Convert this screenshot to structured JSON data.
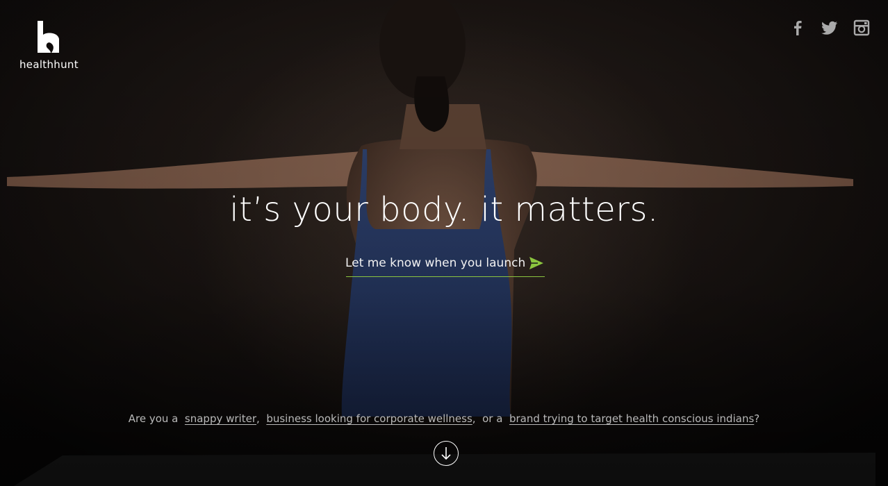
{
  "brand": {
    "name": "healthhunt"
  },
  "social": [
    {
      "name": "facebook-icon"
    },
    {
      "name": "twitter-icon"
    },
    {
      "name": "instagram-icon"
    }
  ],
  "hero": {
    "headline": "it’s your body. it matters."
  },
  "signup": {
    "placeholder": "Let me know when you launch"
  },
  "question": {
    "prefix": "Are you a",
    "link1": "snappy writer",
    "sep1": ",",
    "link2": "business looking for corporate wellness",
    "sep2": ",  or a",
    "link3": "brand trying to target health conscious indians",
    "suffix": "?"
  },
  "colors": {
    "accent": "#8cc63f",
    "background": "#000000",
    "top": "#3b4d82"
  }
}
